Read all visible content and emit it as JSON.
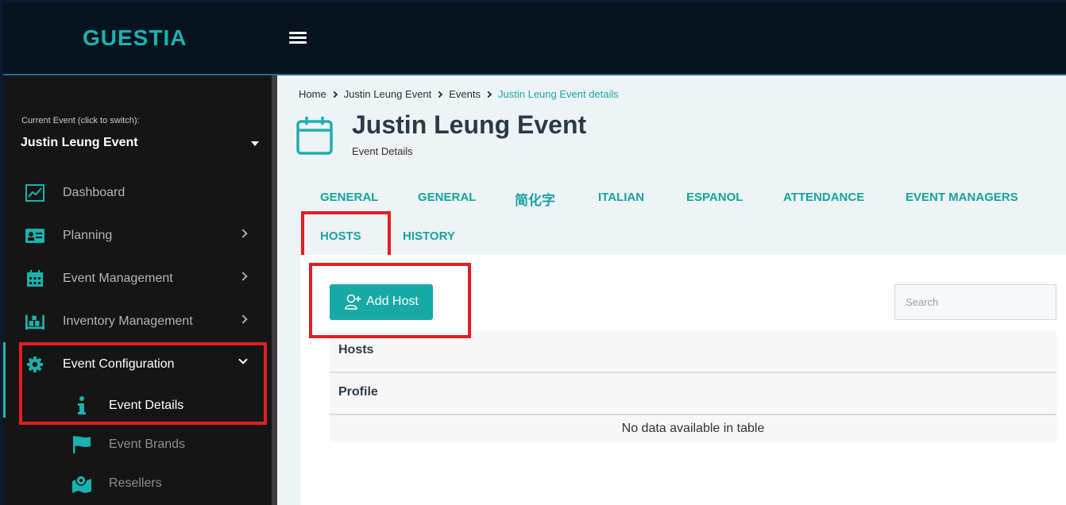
{
  "app": {
    "logo_text": "GUESTIA"
  },
  "sidebar": {
    "current_event_label": "Current Event (click to switch):",
    "current_event_name": "Justin Leung Event",
    "items": [
      {
        "label": "Dashboard",
        "icon": "chart-line-icon"
      },
      {
        "label": "Planning",
        "icon": "id-card-icon"
      },
      {
        "label": "Event Management",
        "icon": "calendar-grid-icon"
      },
      {
        "label": "Inventory Management",
        "icon": "warehouse-icon"
      },
      {
        "label": "Event Configuration",
        "icon": "gear-icon"
      }
    ],
    "subitems": [
      {
        "label": "Event Details",
        "icon": "info-icon"
      },
      {
        "label": "Event Brands",
        "icon": "flag-icon"
      },
      {
        "label": "Resellers",
        "icon": "map-marker-icon"
      }
    ]
  },
  "breadcrumb": [
    "Home",
    "Justin Leung Event",
    "Events",
    "Justin Leung Event details"
  ],
  "page": {
    "title": "Justin Leung Event",
    "subtitle": "Event Details"
  },
  "tabs": [
    "GENERAL",
    "GENERAL",
    "简化字",
    "ITALIAN",
    "ESPANOL",
    "ATTENDANCE",
    "EVENT MANAGERS",
    "HOSTS",
    "HISTORY"
  ],
  "active_tab": "HOSTS",
  "hosts": {
    "add_button": "Add Host",
    "search_placeholder": "Search",
    "columns": [
      "Hosts",
      "Profile"
    ],
    "empty_text": "No data available in table"
  },
  "colors": {
    "accent": "#17a9a6",
    "highlight": "#e02020",
    "sidebar_bg": "#151515",
    "topbar_bg": "#07141f"
  }
}
